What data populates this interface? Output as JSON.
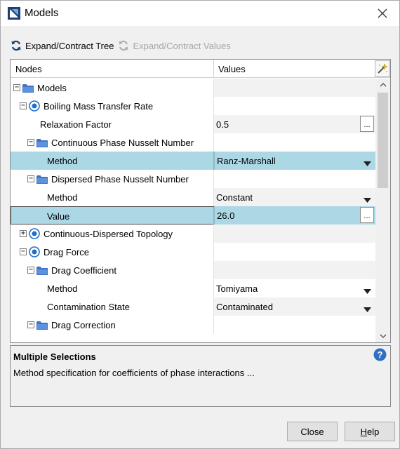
{
  "window": {
    "title": "Models",
    "close_glyph": "✕"
  },
  "toolbar": {
    "expand_tree_label": "Expand/Contract Tree",
    "expand_values_label": "Expand/Contract Values"
  },
  "tree": {
    "columns": {
      "nodes": "Nodes",
      "values": "Values"
    },
    "rows": [
      {
        "label": "Models",
        "value": ""
      },
      {
        "label": "Boiling Mass Transfer Rate",
        "value": ""
      },
      {
        "label": "Relaxation Factor",
        "value": "0.5"
      },
      {
        "label": "Continuous Phase Nusselt Number",
        "value": ""
      },
      {
        "label": "Method",
        "value": "Ranz-Marshall"
      },
      {
        "label": "Dispersed Phase Nusselt Number",
        "value": ""
      },
      {
        "label": "Method",
        "value": "Constant"
      },
      {
        "label": "Value",
        "value": "26.0"
      },
      {
        "label": "Continuous-Dispersed Topology",
        "value": ""
      },
      {
        "label": "Drag Force",
        "value": ""
      },
      {
        "label": "Drag Coefficient",
        "value": ""
      },
      {
        "label": "Method",
        "value": "Tomiyama"
      },
      {
        "label": "Contamination State",
        "value": "Contaminated"
      },
      {
        "label": "Drag Correction",
        "value": ""
      }
    ],
    "ellipsis": "..."
  },
  "info": {
    "title": "Multiple Selections",
    "description": "Method specification for coefficients of phase interactions ..."
  },
  "buttons": {
    "close": "Close",
    "help_rest": "elp",
    "help_mnemonic": "H"
  },
  "colors": {
    "selection": "#acd8e5",
    "folder": "#3e74c4",
    "accent_blue": "#1f6fc6"
  }
}
